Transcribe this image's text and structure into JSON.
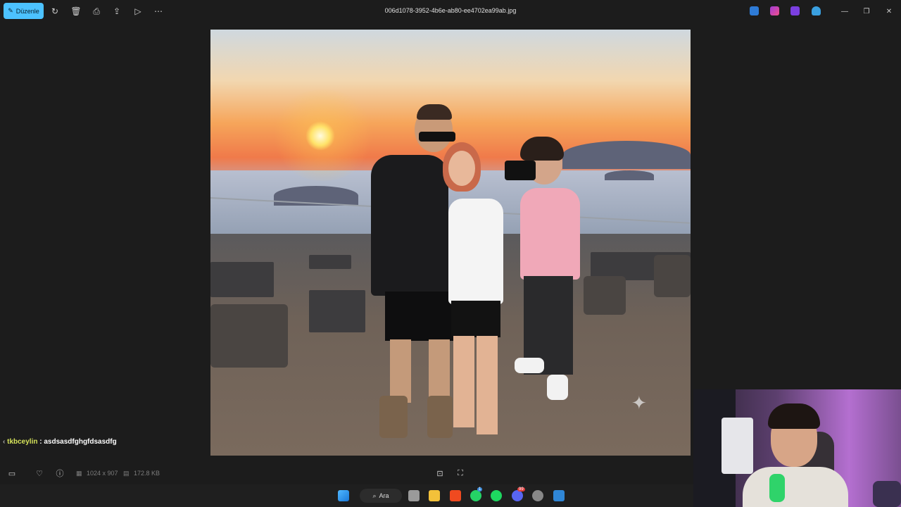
{
  "toolbar": {
    "edit_label": "Düzenle",
    "filename": "006d1078-3952-4b6e-ab80-ee4702ea99ab.jpg"
  },
  "colors": {
    "accent": "#4cc2ff",
    "chat_user": "#d6e35a",
    "background": "#1c1c1c"
  },
  "chat": {
    "user": "tkbceylin",
    "separator": " : ",
    "message": "asdsasdfghgfdsasdfg"
  },
  "image_info": {
    "dimensions": "1024 x 907",
    "file_size": "172.8 KB"
  },
  "taskbar": {
    "search_label": "Ara",
    "whatsapp_badge": "1",
    "discord_badge": "99"
  },
  "icons": [
    "edit-icon",
    "rotate-icon",
    "delete-icon",
    "print-icon",
    "share-icon",
    "slideshow-icon",
    "more-icon",
    "filmstrip-icon",
    "heart-icon",
    "info-icon",
    "zoom-fit-icon",
    "crop-icon",
    "minimize-icon",
    "maximize-icon",
    "close-icon"
  ]
}
